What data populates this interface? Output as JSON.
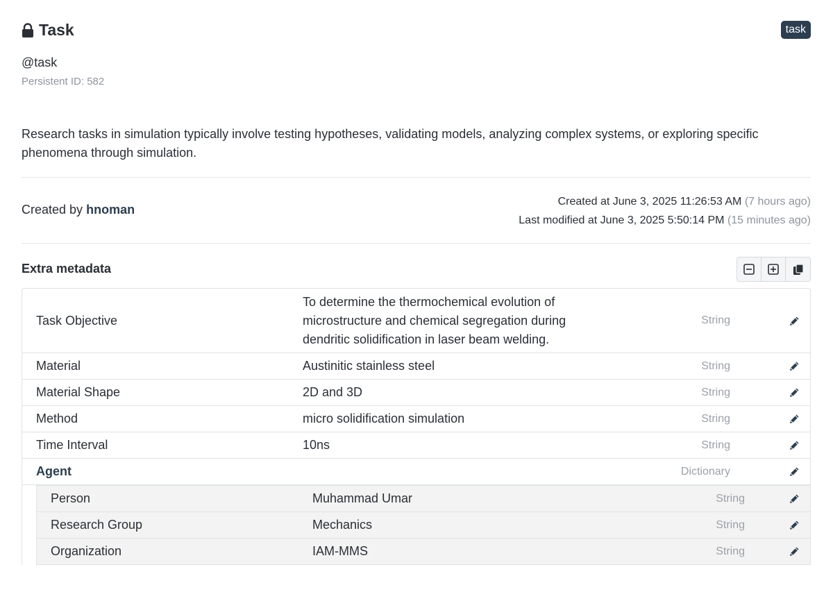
{
  "header": {
    "title": "Task",
    "badge": "task",
    "identifier": "@task",
    "persistent_id": "Persistent ID: 582"
  },
  "description": "Research tasks in simulation typically involve testing hypotheses, validating models, analyzing complex systems, or exploring specific phenomena through simulation.",
  "meta": {
    "created_by_prefix": "Created by",
    "created_by_user": "hnoman",
    "created_at": "Created at June 3, 2025 11:26:53 AM",
    "created_rel": "(7 hours ago)",
    "modified_at": "Last modified at June 3, 2025 5:50:14 PM",
    "modified_rel": "(15 minutes ago)"
  },
  "extras": {
    "title": "Extra metadata",
    "rows": [
      {
        "key": "Task Objective",
        "value": "To determine the thermochemical evolution of microstructure and chemical segregation during dendritic solidification in laser beam welding.",
        "type": "String"
      },
      {
        "key": "Material",
        "value": "Austinitic stainless steel",
        "type": "String"
      },
      {
        "key": "Material Shape",
        "value": "2D and 3D",
        "type": "String"
      },
      {
        "key": "Method",
        "value": "micro solidification simulation",
        "type": "String"
      },
      {
        "key": "Time Interval",
        "value": "10ns",
        "type": "String"
      },
      {
        "key": "Agent",
        "value": "",
        "type": "Dictionary"
      }
    ],
    "agent_rows": [
      {
        "key": "Person",
        "value": "Muhammad Umar",
        "type": "String"
      },
      {
        "key": "Research Group",
        "value": "Mechanics",
        "type": "String"
      },
      {
        "key": "Organization",
        "value": "IAM-MMS",
        "type": "String"
      }
    ]
  },
  "icons": {
    "lock": "lock-icon",
    "collapse": "minus-square-icon",
    "expand": "plus-square-icon",
    "copy": "copy-icon",
    "edit": "pencil-icon"
  },
  "colors": {
    "text": "#2a2f36",
    "muted": "#8d959e",
    "accent": "#2c3e50",
    "border": "#dfe2e5",
    "nested_bg": "#f3f3f3"
  }
}
